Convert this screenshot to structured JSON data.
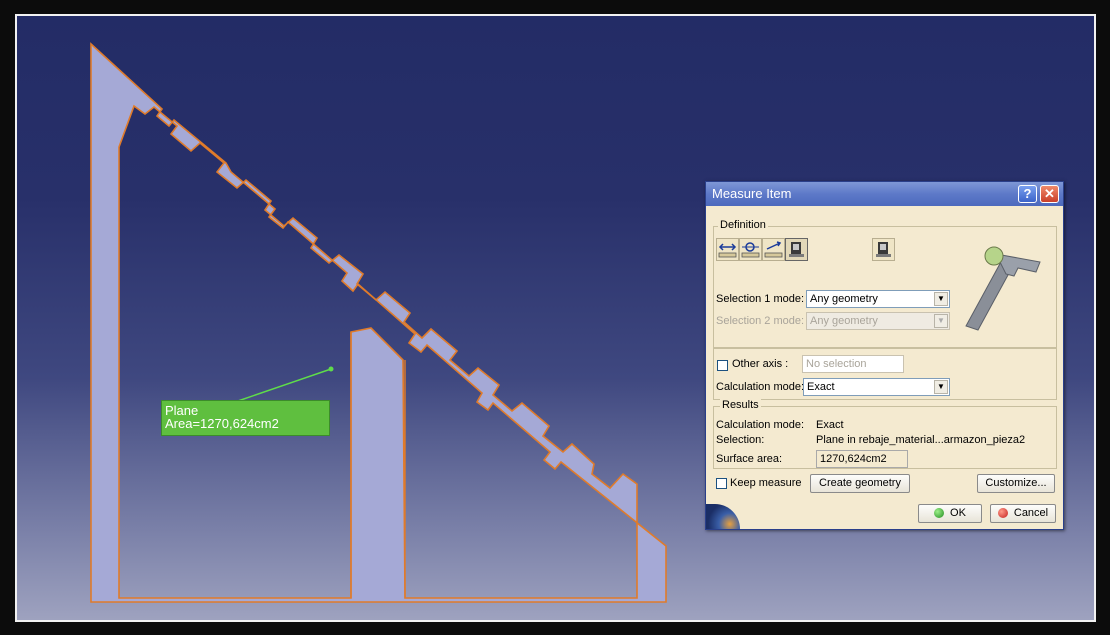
{
  "dialog": {
    "title": "Measure Item",
    "help_label": "?",
    "close_label": "✕",
    "definition": {
      "legend": "Definition",
      "tools": [
        "measure-between-icon",
        "measure-item-icon",
        "measure-thickness-icon",
        "measure-inertia-icon",
        "measure-inertia-2d-icon"
      ],
      "selection1_label": "Selection 1 mode:",
      "selection1_value": "Any geometry",
      "selection2_label": "Selection 2 mode:",
      "selection2_value": "Any geometry"
    },
    "other_axis_label": "Other axis :",
    "other_axis_value": "No selection",
    "calc_mode_label": "Calculation mode:",
    "calc_mode_value": "Exact",
    "results": {
      "legend": "Results",
      "calc_mode_label": "Calculation mode:",
      "calc_mode_value": "Exact",
      "selection_label": "Selection:",
      "selection_value": "Plane in rebaje_material...armazon_pieza2",
      "surface_area_label": "Surface area:",
      "surface_area_value": "1270,624cm2"
    },
    "keep_measure_label": "Keep measure",
    "create_geometry_label": "Create geometry",
    "customize_label": "Customize...",
    "ok_label": "OK",
    "cancel_label": "Cancel"
  },
  "annotation": {
    "line1": "Plane",
    "line2": "Area=1270,624cm2"
  },
  "colors": {
    "part_fill": "#a5a9d6",
    "part_edge": "#e07b2a",
    "annotation_bg": "#5fbf3f",
    "leader_line": "#5fdc4a"
  }
}
